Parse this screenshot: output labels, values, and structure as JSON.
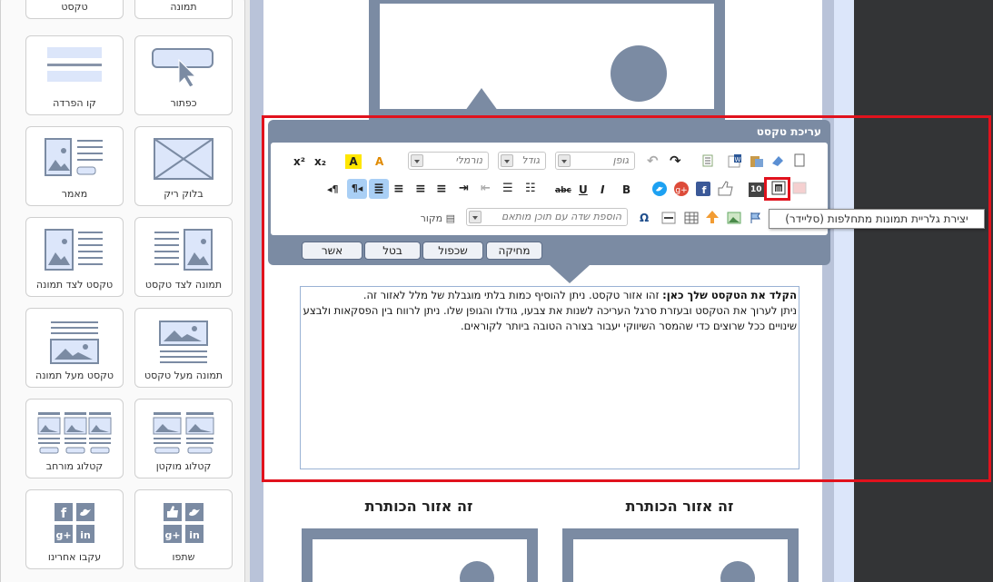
{
  "left_panel": {
    "tiles": [
      {
        "label": "טקסט"
      },
      {
        "label": "תמונה"
      },
      {
        "label": "קו הפרדה"
      },
      {
        "label": "כפתור"
      },
      {
        "label": "מאמר"
      },
      {
        "label": "בלוק ריק"
      },
      {
        "label": "טקסט לצד תמונה"
      },
      {
        "label": "תמונה לצד טקסט"
      },
      {
        "label": "טקסט מעל תמונה"
      },
      {
        "label": "תמונה מעל טקסט"
      },
      {
        "label": "קטלוג מורחב"
      },
      {
        "label": "קטלוג מוקטן"
      },
      {
        "label": "עקבו אחרינו"
      },
      {
        "label": "שתפו"
      }
    ]
  },
  "editor": {
    "title": "עריכת טקסט",
    "font_select": "גופן",
    "size_select": "גודל",
    "format_select": "נורמלי",
    "merge_field_select": "הוספת שדה עם תוכן מותאם",
    "source_label": "מקור",
    "buttons": {
      "approve": "אשר",
      "cancel": "בטל",
      "duplicate": "שכפול",
      "delete": "מחיקה"
    },
    "tooltip": "יצירת גלריית תמונות מתחלפות (סליידר)",
    "body_bold": "הקלד את הטקסט שלך כאן:",
    "body_line1": " זהו אזור טקסט. ניתן להוסיף כמות בלתי מוגבלת של מלל לאזור זה.",
    "body_line2": "ניתן לערוך את הטקסט ובעזרת סרגל העריכה לשנות את צבעו, גודלו והגופן שלו. ניתן לרווח בין הפסקאות ולבצע שינויים ככל שרוצים כדי שהמסר השיווקי יעבור בצורה הטובה ביותר לקוראים."
  },
  "content": {
    "heading_left": "זה אזור הכותרת",
    "heading_right": "זה אזור הכותרת"
  },
  "colors": {
    "highlight": "#e1121d",
    "placeholder": "#7b8ba3",
    "editor_bar": "#7b8ba3"
  }
}
